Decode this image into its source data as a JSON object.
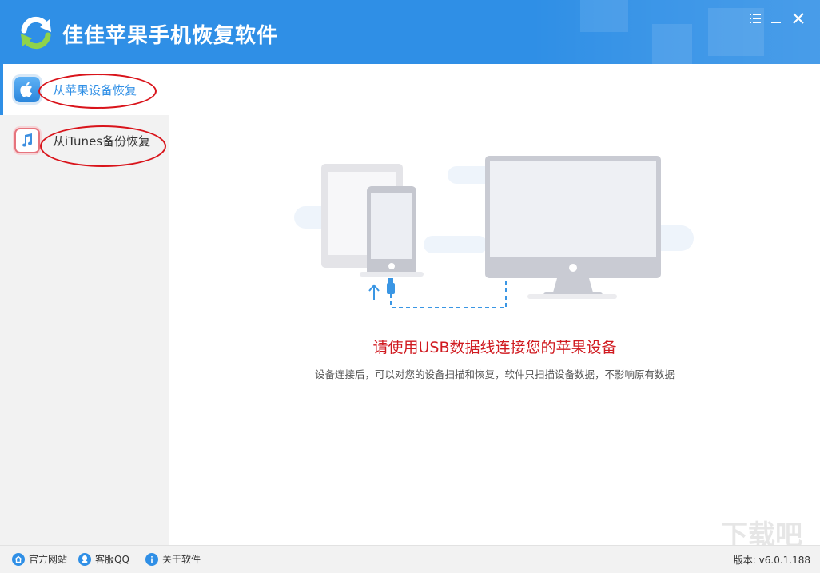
{
  "app": {
    "title": "佳佳苹果手机恢复软件"
  },
  "window_controls": {
    "menu_icon": "menu-icon",
    "minimize_icon": "minimize-icon",
    "close_icon": "close-icon"
  },
  "sidebar": {
    "items": [
      {
        "label": "从苹果设备恢复",
        "icon": "apple-icon",
        "active": true
      },
      {
        "label": "从iTunes备份恢复",
        "icon": "music-note-icon",
        "active": false
      }
    ]
  },
  "main": {
    "heading": "请使用USB数据线连接您的苹果设备",
    "subtext": "设备连接后，可以对您的设备扫描和恢复，软件只扫描设备数据，不影响原有数据"
  },
  "footer": {
    "links": [
      {
        "label": "官方网站",
        "icon": "home-icon"
      },
      {
        "label": "客服QQ",
        "icon": "qq-icon"
      },
      {
        "label": "关于软件",
        "icon": "info-icon"
      }
    ],
    "version": "版本: v6.0.1.188"
  },
  "colors": {
    "header_bg": "#2f8fe6",
    "accent": "#2f8fe6",
    "heading_red": "#d01a20",
    "annotation_red": "#d9141b",
    "sidebar_bg": "#f2f2f2"
  }
}
